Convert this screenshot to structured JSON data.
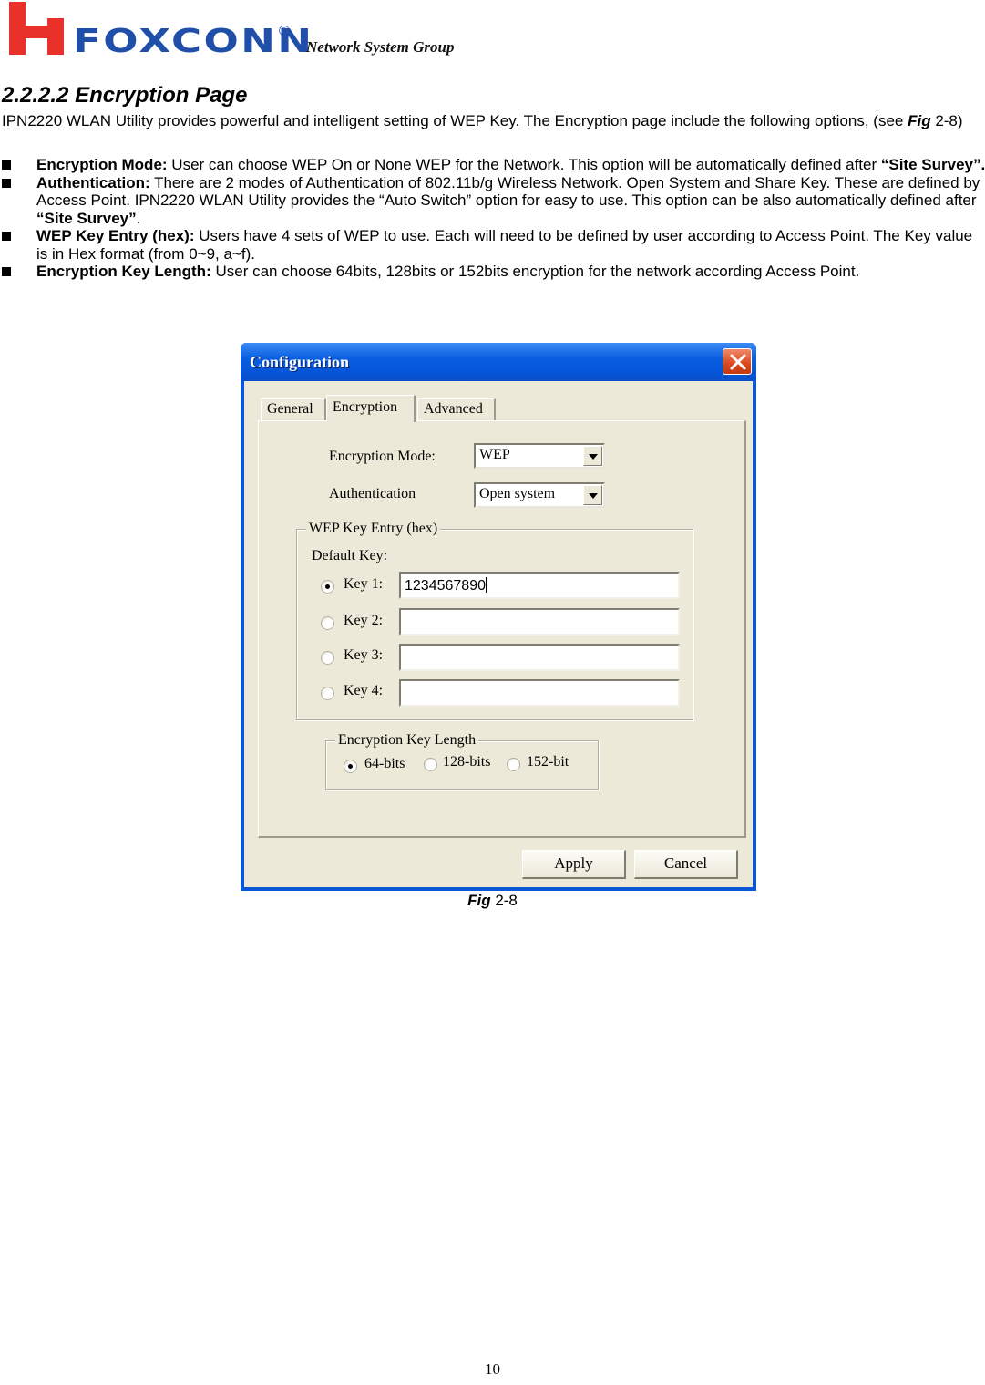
{
  "header": {
    "brand": "FOXCONN",
    "registered_mark": "®",
    "tagline": "Network  System  Group"
  },
  "section": {
    "heading": "2.2.2.2 Encryption Page",
    "intro_text": "IPN2220 WLAN Utility provides powerful and intelligent setting of WEP Key. The Encryption page include the following options, (see ",
    "intro_fig_word": "Fig",
    "intro_fig_num": " 2-8)",
    "bullets": [
      {
        "term": "Encryption Mode:",
        "text": " User can choose WEP On or None WEP for the Network. This option will be automatically defined after ",
        "emph": "“Site Survey”.",
        "tail": ""
      },
      {
        "term": "Authentication:",
        "text": " There are 2 modes of Authentication of 802.11b/g Wireless Network. Open System and Share Key. These are defined by Access Point. IPN2220 WLAN Utility provides the “Auto Switch” option for easy to use. This option can be also automatically defined after ",
        "emph": "“Site Survey”",
        "tail": "."
      },
      {
        "term": "WEP Key Entry (hex):",
        "text": " Users have 4 sets of WEP to use. Each will need to be defined by user according to Access Point. The Key value is in Hex format (from 0~9, a~f).",
        "emph": "",
        "tail": ""
      },
      {
        "term": "Encryption Key Length:",
        "text": " User can choose 64bits, 128bits or 152bits encryption for the network according Access Point.",
        "emph": "",
        "tail": ""
      }
    ]
  },
  "dialog": {
    "title": "Configuration",
    "tabs": [
      {
        "label": "General",
        "active": false
      },
      {
        "label": "Encryption",
        "active": true
      },
      {
        "label": "Advanced",
        "active": false
      }
    ],
    "encryption_mode": {
      "label": "Encryption Mode:",
      "value": "WEP"
    },
    "authentication": {
      "label": "Authentication",
      "value": "Open system"
    },
    "wep_group": {
      "legend": "WEP Key Entry (hex)",
      "default_key_label": "Default Key:",
      "keys": [
        {
          "label": "Key 1:",
          "value": "1234567890",
          "selected": true
        },
        {
          "label": "Key 2:",
          "value": "",
          "selected": false
        },
        {
          "label": "Key 3:",
          "value": "",
          "selected": false
        },
        {
          "label": "Key 4:",
          "value": "",
          "selected": false
        }
      ]
    },
    "key_length_group": {
      "legend": "Encryption Key Length",
      "options": [
        {
          "label": "64-bits",
          "selected": true
        },
        {
          "label": "128-bits",
          "selected": false
        },
        {
          "label": "152-bit",
          "selected": false
        }
      ]
    },
    "buttons": {
      "apply": "Apply",
      "cancel": "Cancel"
    },
    "colors": {
      "titlebar": "#0a58d8",
      "client": "#ece9d8",
      "close": "#d9481e"
    }
  },
  "figure": {
    "caption_word": "Fig",
    "caption_num": " 2-8"
  },
  "footer": {
    "page_number": "10"
  }
}
